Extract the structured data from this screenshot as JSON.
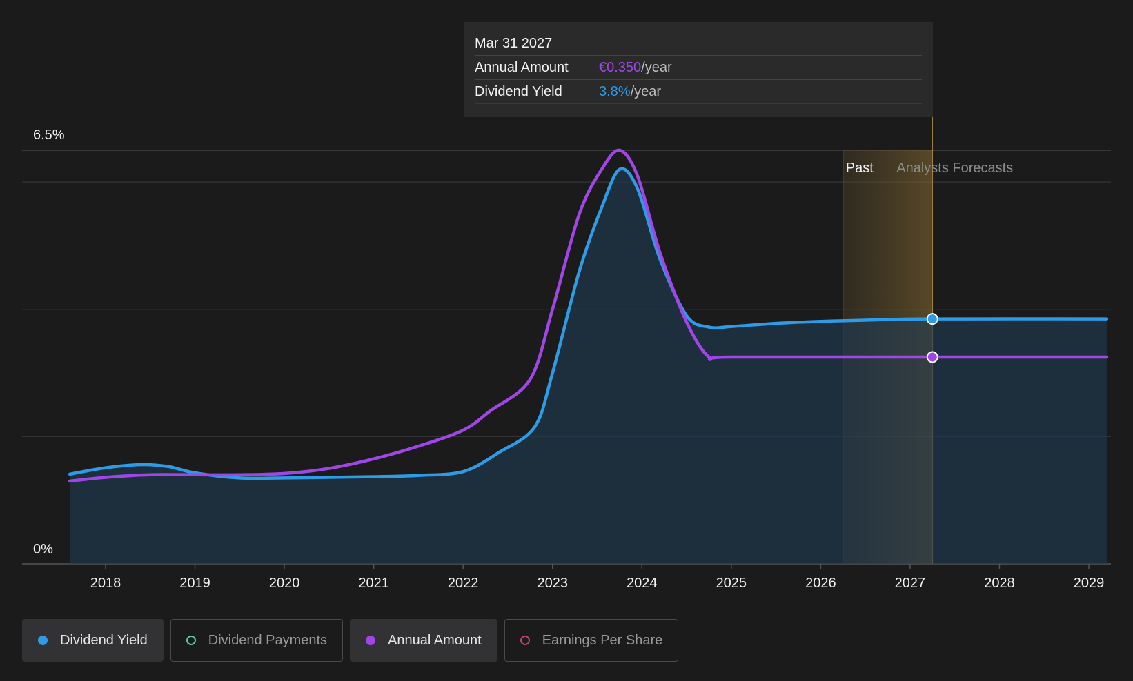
{
  "chart_data": {
    "type": "line",
    "y_axis": {
      "min": 0,
      "max": 6.5,
      "labels": [
        "6.5%",
        "0%"
      ]
    },
    "x_axis": {
      "min": 2017.6,
      "max": 2029.2,
      "ticks": [
        "2018",
        "2019",
        "2020",
        "2021",
        "2022",
        "2023",
        "2024",
        "2025",
        "2026",
        "2027",
        "2028",
        "2029"
      ]
    },
    "grid": true,
    "regions": {
      "past_label": "Past",
      "forecast_label": "Analysts Forecasts",
      "past_start": 2026.25,
      "divider": 2027.25
    },
    "series": [
      {
        "name": "Dividend Yield",
        "color": "#2d9be5",
        "area": true,
        "points": [
          [
            2017.6,
            1.41
          ],
          [
            2018.0,
            1.51
          ],
          [
            2018.4,
            1.56
          ],
          [
            2018.7,
            1.53
          ],
          [
            2019.0,
            1.43
          ],
          [
            2019.5,
            1.35
          ],
          [
            2020.0,
            1.35
          ],
          [
            2020.5,
            1.36
          ],
          [
            2021.0,
            1.37
          ],
          [
            2021.5,
            1.39
          ],
          [
            2022.0,
            1.45
          ],
          [
            2022.4,
            1.75
          ],
          [
            2022.8,
            2.15
          ],
          [
            2023.0,
            3.0
          ],
          [
            2023.3,
            4.6
          ],
          [
            2023.55,
            5.6
          ],
          [
            2023.75,
            6.2
          ],
          [
            2023.95,
            5.9
          ],
          [
            2024.2,
            4.8
          ],
          [
            2024.5,
            3.9
          ],
          [
            2024.75,
            3.72
          ],
          [
            2025.0,
            3.73
          ],
          [
            2025.5,
            3.78
          ],
          [
            2026.0,
            3.81
          ],
          [
            2026.5,
            3.83
          ],
          [
            2027.25,
            3.85
          ],
          [
            2029.2,
            3.85
          ]
        ]
      },
      {
        "name": "Annual Amount",
        "color": "#a046e6",
        "area": false,
        "points": [
          [
            2017.6,
            1.3
          ],
          [
            2018.0,
            1.36
          ],
          [
            2018.5,
            1.4
          ],
          [
            2019.0,
            1.4
          ],
          [
            2019.5,
            1.4
          ],
          [
            2020.0,
            1.42
          ],
          [
            2020.5,
            1.5
          ],
          [
            2021.0,
            1.65
          ],
          [
            2021.5,
            1.85
          ],
          [
            2022.0,
            2.1
          ],
          [
            2022.3,
            2.4
          ],
          [
            2022.75,
            2.9
          ],
          [
            2023.0,
            4.0
          ],
          [
            2023.3,
            5.5
          ],
          [
            2023.55,
            6.2
          ],
          [
            2023.75,
            6.5
          ],
          [
            2023.95,
            6.1
          ],
          [
            2024.2,
            4.9
          ],
          [
            2024.5,
            3.8
          ],
          [
            2024.75,
            3.25
          ],
          [
            2025.0,
            3.25
          ],
          [
            2027.25,
            3.25
          ],
          [
            2029.2,
            3.25
          ]
        ]
      }
    ],
    "markers": [
      {
        "series": "Dividend Yield",
        "x": 2027.25,
        "y": 3.85
      },
      {
        "series": "Annual Amount",
        "x": 2027.25,
        "y": 3.25
      }
    ]
  },
  "tooltip": {
    "date": "Mar 31 2027",
    "rows": [
      {
        "label": "Annual Amount",
        "value": "€0.350",
        "unit": "/year",
        "color": "#a046e6"
      },
      {
        "label": "Dividend Yield",
        "value": "3.8%",
        "unit": "/year",
        "color": "#2d9be5"
      }
    ]
  },
  "legend": [
    {
      "label": "Dividend Yield",
      "color": "#2d9be5",
      "active": true
    },
    {
      "label": "Dividend Payments",
      "color": "#58c7b4",
      "active": false
    },
    {
      "label": "Annual Amount",
      "color": "#a046e6",
      "active": true
    },
    {
      "label": "Earnings Per Share",
      "color": "#c0407a",
      "active": false
    }
  ]
}
